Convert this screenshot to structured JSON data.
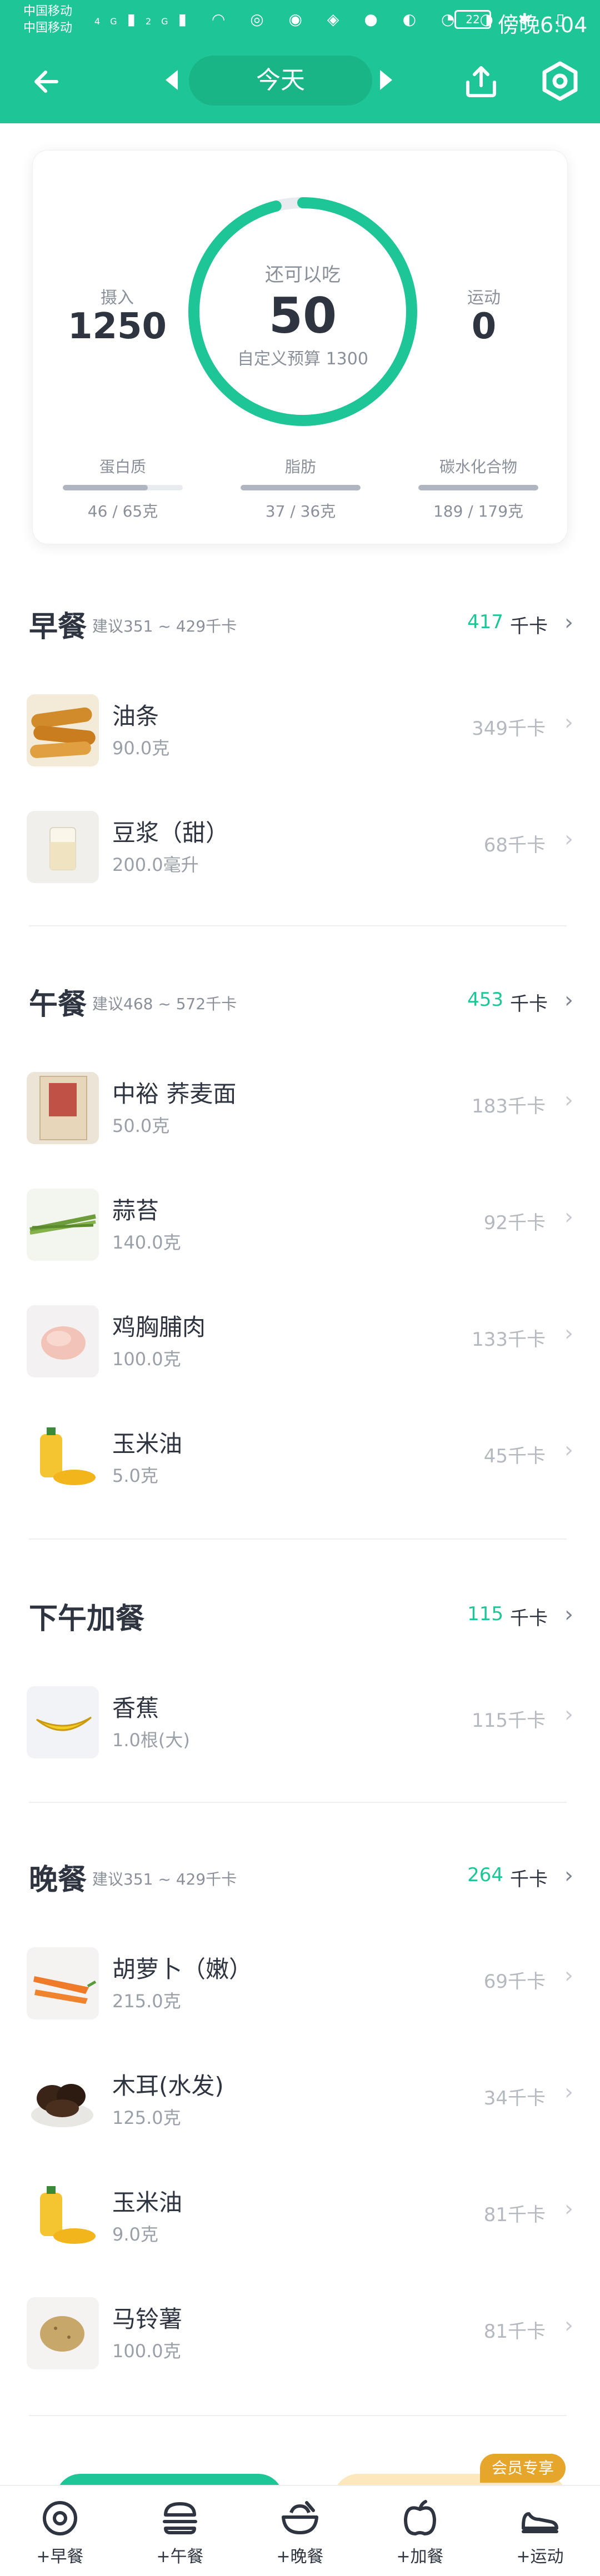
{
  "status_bar": {
    "carrier_1": "中国移动",
    "carrier_2": "中国移动",
    "network_1": "4G",
    "network_2": "2G",
    "battery": "22",
    "time": "傍晚6:04"
  },
  "app_bar": {
    "date_label": "今天",
    "icons": [
      "back-arrow-icon",
      "prev-day-icon",
      "next-day-icon",
      "share-icon",
      "settings-icon"
    ]
  },
  "summary": {
    "intake_label": "摄入",
    "intake_value": "1250",
    "remaining_label": "还可以吃",
    "remaining_value": "50",
    "budget_label": "自定义预算 1300",
    "exercise_label": "运动",
    "exercise_value": "0",
    "ring_progress": 0.96,
    "macros": [
      {
        "name": "蛋白质",
        "value": "46 / 65克",
        "fraction": 0.71
      },
      {
        "name": "脂肪",
        "value": "37 / 36克",
        "fraction": 1.0
      },
      {
        "name": "碳水化合物",
        "value": "189 / 179克",
        "fraction": 1.0
      }
    ]
  },
  "meals": [
    {
      "title": "早餐",
      "suggest": "建议351 ~ 429千卡",
      "kcal": "417",
      "unit": "千卡",
      "items": [
        {
          "name": "油条",
          "amount": "90.0克",
          "kcal": "349千卡",
          "thumb": "youtiao"
        },
        {
          "name": "豆浆（甜）",
          "amount": "200.0毫升",
          "kcal": "68千卡",
          "thumb": "soymilk"
        }
      ]
    },
    {
      "title": "午餐",
      "suggest": "建议468 ~ 572千卡",
      "kcal": "453",
      "unit": "千卡",
      "items": [
        {
          "name": "中裕 荞麦面",
          "amount": "50.0克",
          "kcal": "183千卡",
          "thumb": "noodles"
        },
        {
          "name": "蒜苔",
          "amount": "140.0克",
          "kcal": "92千卡",
          "thumb": "garlic-shoots"
        },
        {
          "name": "鸡胸脯肉",
          "amount": "100.0克",
          "kcal": "133千卡",
          "thumb": "chicken"
        },
        {
          "name": "玉米油",
          "amount": "5.0克",
          "kcal": "45千卡",
          "thumb": "corn-oil"
        }
      ]
    },
    {
      "title": "下午加餐",
      "suggest": "",
      "kcal": "115",
      "unit": "千卡",
      "items": [
        {
          "name": "香蕉",
          "amount": "1.0根(大)",
          "kcal": "115千卡",
          "thumb": "banana"
        }
      ]
    },
    {
      "title": "晚餐",
      "suggest": "建议351 ~ 429千卡",
      "kcal": "264",
      "unit": "千卡",
      "items": [
        {
          "name": "胡萝卜（嫩）",
          "amount": "215.0克",
          "kcal": "69千卡",
          "thumb": "carrot"
        },
        {
          "name": "木耳(水发)",
          "amount": "125.0克",
          "kcal": "34千卡",
          "thumb": "fungus"
        },
        {
          "name": "玉米油",
          "amount": "9.0克",
          "kcal": "81千卡",
          "thumb": "corn-oil"
        },
        {
          "name": "马铃薯",
          "amount": "100.0克",
          "kcal": "81千卡",
          "thumb": "potato"
        }
      ]
    }
  ],
  "member_badge": "会员专享",
  "bottom_nav": [
    {
      "label": "+早餐",
      "icon": "breakfast-icon"
    },
    {
      "label": "+午餐",
      "icon": "lunch-icon"
    },
    {
      "label": "+晚餐",
      "icon": "dinner-icon"
    },
    {
      "label": "+加餐",
      "icon": "snack-icon"
    },
    {
      "label": "+运动",
      "icon": "exercise-icon"
    }
  ],
  "colors": {
    "primary": "#1ec596",
    "text": "#2f3540",
    "muted": "#8a9099",
    "badge": "#e6a52b"
  }
}
